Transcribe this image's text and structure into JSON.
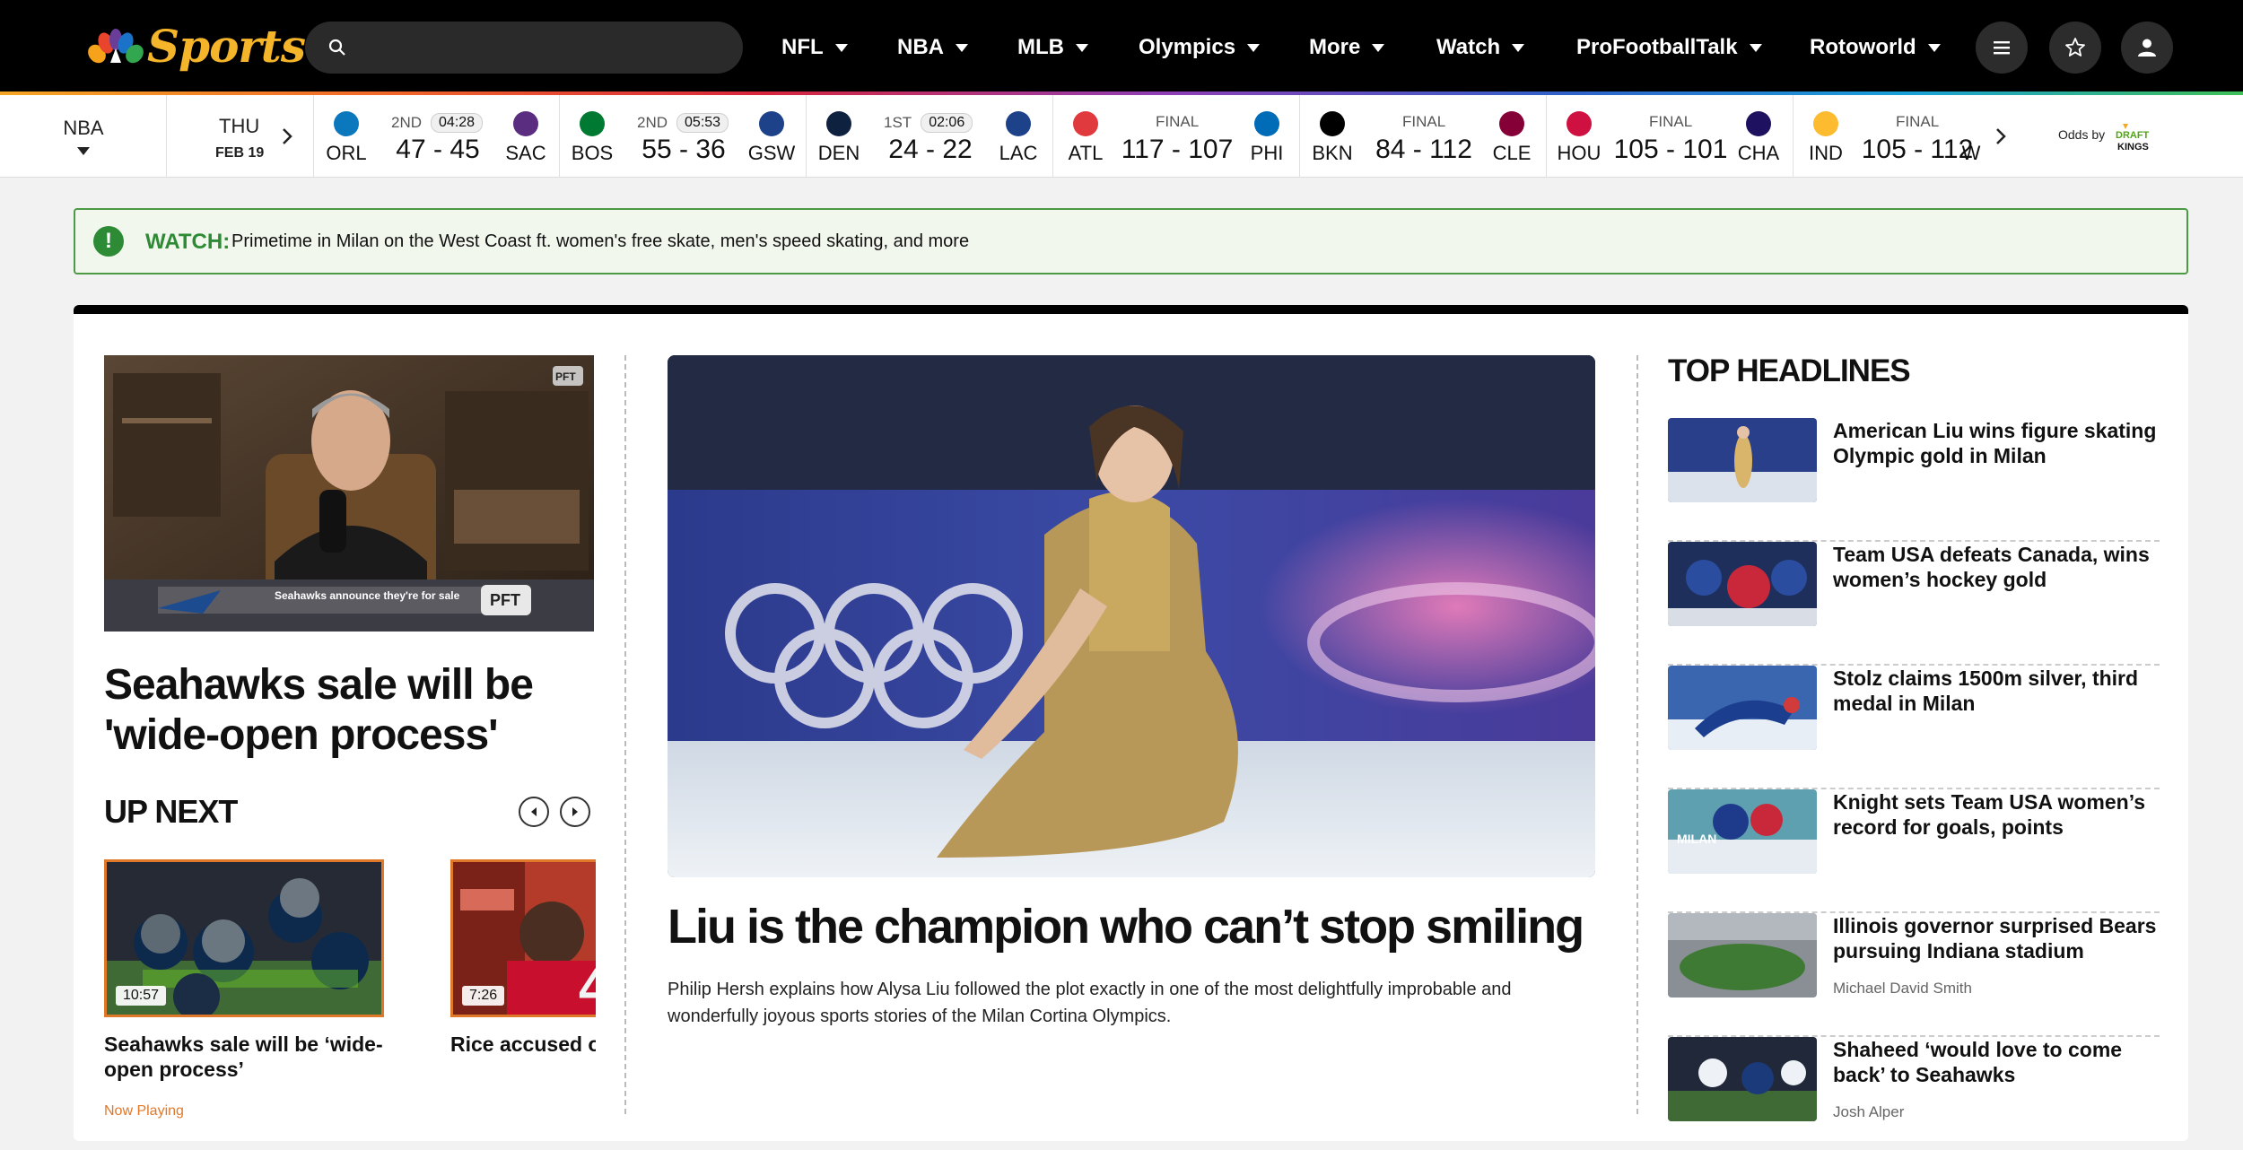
{
  "brand": {
    "logo_text": "Sports"
  },
  "search": {
    "placeholder": ""
  },
  "nav": {
    "items": [
      {
        "label": "NFL"
      },
      {
        "label": "NBA"
      },
      {
        "label": "MLB"
      },
      {
        "label": "Olympics"
      },
      {
        "label": "More"
      },
      {
        "label": "Watch"
      },
      {
        "label": "ProFootballTalk"
      },
      {
        "label": "Rotoworld"
      }
    ],
    "icons": [
      "menu-icon",
      "star-icon",
      "user-icon"
    ]
  },
  "scores": {
    "league": "NBA",
    "date_day": "THU",
    "date_md": "FEB 19",
    "games": [
      {
        "status": "2ND",
        "clock": "04:28",
        "away": "ORL",
        "home": "SAC",
        "score": "47 - 45",
        "away_color": "#0b77bd",
        "home_color": "#5a2d81"
      },
      {
        "status": "2ND",
        "clock": "05:53",
        "away": "BOS",
        "home": "GSW",
        "score": "55 - 36",
        "away_color": "#007a33",
        "home_color": "#1d428a"
      },
      {
        "status": "1ST",
        "clock": "02:06",
        "away": "DEN",
        "home": "LAC",
        "score": "24 - 22",
        "away_color": "#0e2240",
        "home_color": "#1d428a"
      },
      {
        "status": "FINAL",
        "clock": "",
        "away": "ATL",
        "home": "PHI",
        "score": "117 - 107",
        "away_color": "#e03a3e",
        "home_color": "#006bb6"
      },
      {
        "status": "FINAL",
        "clock": "",
        "away": "BKN",
        "home": "CLE",
        "score": "84 - 112",
        "away_color": "#000000",
        "home_color": "#860038"
      },
      {
        "status": "FINAL",
        "clock": "",
        "away": "HOU",
        "home": "CHA",
        "score": "105 - 101",
        "away_color": "#ce1141",
        "home_color": "#1d1160"
      },
      {
        "status": "FINAL",
        "clock": "",
        "away": "IND",
        "home": "W",
        "score": "105 - 112",
        "away_color": "#fdbb30",
        "home_color": "#002b5c"
      }
    ],
    "odds_label": "Odds by",
    "odds_brand": "DRAFT KINGS"
  },
  "alert": {
    "label": "WATCH:",
    "message": "Primetime in Milan on the West Coast ft. women's free skate, men's speed skating, and more"
  },
  "left": {
    "video_caption": "Seahawks announce they're for sale",
    "video_badge": "PFT",
    "title": "Seahawks sale will be 'wide-open process'",
    "up_next_label": "UP NEXT",
    "up_next": [
      {
        "title": "Seahawks sale will be ‘wide-open process’",
        "duration": "10:57",
        "status": "Now Playing"
      },
      {
        "title": "Rice accused of violence in new",
        "duration": "7:26",
        "status": ""
      }
    ]
  },
  "hero": {
    "title": "Liu is the champion who can’t stop smiling",
    "description": "Philip Hersh explains how Alysa Liu followed the plot exactly in one of the most delightfully improbable and wonderfully joyous sports stories of the Milan Cortina Olympics."
  },
  "headlines": {
    "title": "TOP HEADLINES",
    "items": [
      {
        "text": "American Liu wins figure skating Olympic gold in Milan",
        "author": ""
      },
      {
        "text": "Team USA defeats Canada, wins women’s hockey gold",
        "author": ""
      },
      {
        "text": "Stolz claims 1500m silver, third medal in Milan",
        "author": ""
      },
      {
        "text": "Knight sets Team USA women’s record for goals, points",
        "author": ""
      },
      {
        "text": "Illinois governor surprised Bears pursuing Indiana stadium",
        "author": "Michael David Smith"
      },
      {
        "text": "Shaheed ‘would love to come back’ to Seahawks",
        "author": "Josh Alper"
      }
    ]
  }
}
